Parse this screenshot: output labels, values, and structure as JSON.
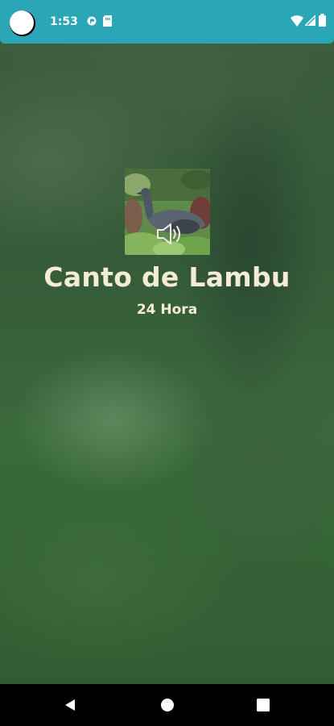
{
  "status_bar": {
    "time": "1:53",
    "background_color": "#2aa6b6",
    "icons": [
      "notification-app-icon",
      "sim-card-icon",
      "wifi-icon",
      "cellular-signal-icon",
      "battery-icon"
    ]
  },
  "main": {
    "title": "Canto de Lambu",
    "duration": "24 Hora",
    "thumbnail": "bird-photo",
    "play_icon": "speaker-icon",
    "text_color": "#f4ecd7"
  },
  "nav_bar": {
    "buttons": [
      "back-icon",
      "home-icon",
      "recents-icon"
    ]
  }
}
